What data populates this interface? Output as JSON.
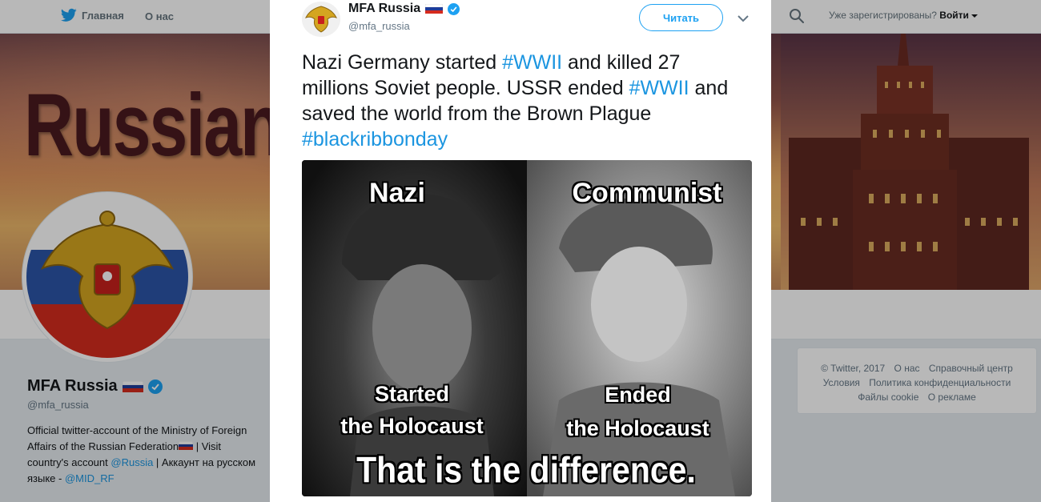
{
  "topnav": {
    "home_label": "Главная",
    "about_label": "О нас",
    "login_prompt": "Уже зарегистрированы?",
    "login_label": "Войти"
  },
  "banner": {
    "word": "Russian"
  },
  "profile": {
    "name": "MFA Russia",
    "handle": "@mfa_russia",
    "bio_line1": "Official twitter-account of the Ministry of Foreign Affairs of the Russian Federation",
    "bio_sep1": " | Visit country's account ",
    "bio_link1": "@Russia",
    "bio_sep2": " | Аккаунт на русском языке - ",
    "bio_link2": "@MID_RF"
  },
  "footer": {
    "links": [
      "© Twitter, 2017",
      "О нас",
      "Справочный центр",
      "Условия",
      "Политика конфиденциальности",
      "Файлы cookie",
      "О рекламе"
    ]
  },
  "tweet": {
    "author_name": "MFA Russia",
    "author_handle": "@mfa_russia",
    "follow_label": "Читать",
    "text_1": "Nazi Germany started ",
    "tag_1": "#WWII",
    "text_2": " and killed 27 millions Soviet people. USSR ended ",
    "tag_2": "#WWII",
    "text_3": " and saved the world from the Brown Plague ",
    "tag_3": "#blackribbonday",
    "meme": {
      "left_title": "Nazi",
      "right_title": "Communist",
      "left_caption_1": "Started",
      "left_caption_2": "the Holocaust",
      "right_caption_1": "Ended",
      "right_caption_2": "the Holocaust",
      "bottom_caption": "That is the difference."
    }
  },
  "colors": {
    "link": "#1b95e0",
    "twitter_blue": "#1da1f2",
    "verified": "#1da1f2"
  }
}
